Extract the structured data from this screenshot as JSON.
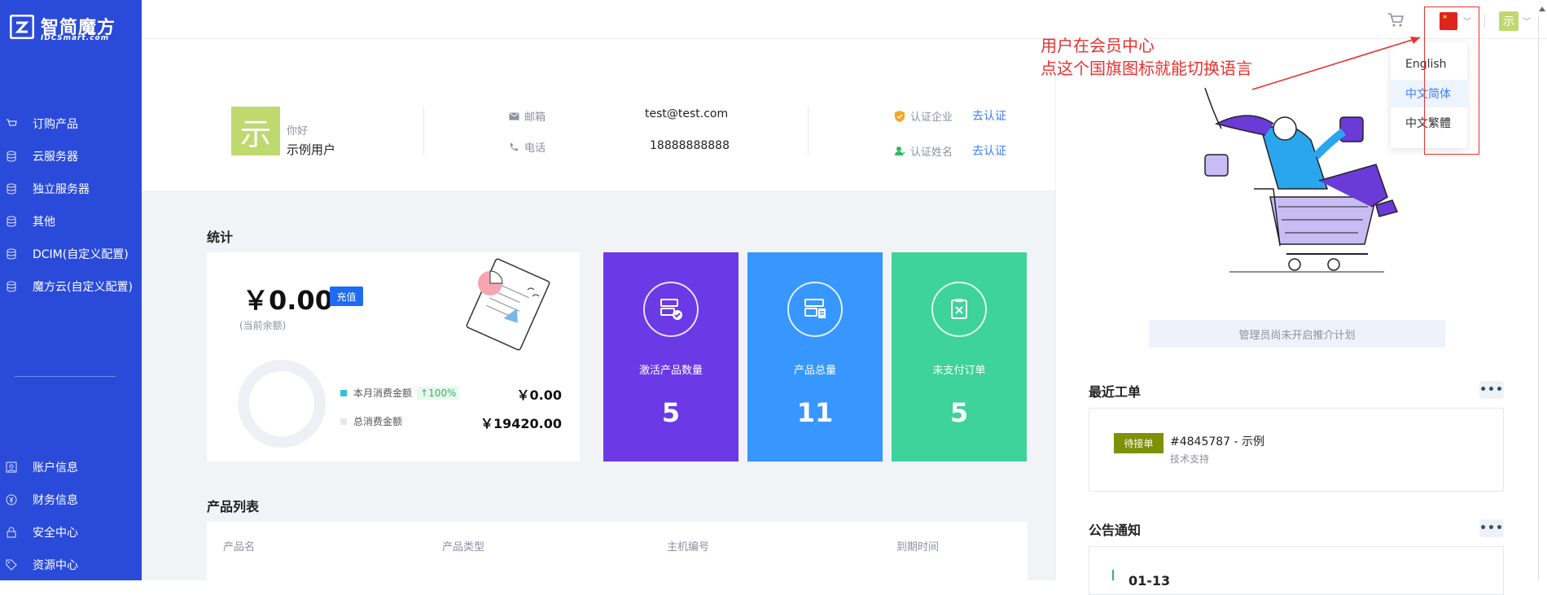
{
  "brand": {
    "name": "智简魔方",
    "sub": "IDCSmart.com"
  },
  "sidebar": {
    "items": [
      {
        "label": "订购产品",
        "icon": "cart-icon"
      },
      {
        "label": "云服务器",
        "icon": "database-icon"
      },
      {
        "label": "独立服务器",
        "icon": "database-icon"
      },
      {
        "label": "其他",
        "icon": "database-icon"
      },
      {
        "label": "DCIM(自定义配置)",
        "icon": "database-icon"
      },
      {
        "label": "魔方云(自定义配置)",
        "icon": "database-icon"
      }
    ],
    "bottom_items": [
      {
        "label": "账户信息",
        "icon": "user-card-icon"
      },
      {
        "label": "财务信息",
        "icon": "yen-icon"
      },
      {
        "label": "安全中心",
        "icon": "lock-icon"
      },
      {
        "label": "资源中心",
        "icon": "tag-icon"
      }
    ]
  },
  "user": {
    "avatar_char": "示",
    "greeting": "你好",
    "name": "示例用户",
    "email_label": "邮箱",
    "email": "test@test.com",
    "phone_label": "电话",
    "phone": "18888888888",
    "company_label": "认证企业",
    "company_action": "去认证",
    "realname_label": "认证姓名",
    "realname_action": "去认证"
  },
  "stats": {
    "title": "统计",
    "balance": "￥0.00",
    "recharge_label": "充值",
    "balance_sub": "(当前余额)",
    "month_label": "本月消费金额",
    "month_pct": "↑100%",
    "month_amount": "￥0.00",
    "total_label": "总消费金额",
    "total_amount": "￥19420.00",
    "cards": [
      {
        "label": "激活产品数量",
        "value": "5",
        "color": "#6b39e6",
        "icon": "server-check-icon"
      },
      {
        "label": "产品总量",
        "value": "11",
        "color": "#3797ff",
        "icon": "server-list-icon"
      },
      {
        "label": "未支付订单",
        "value": "5",
        "color": "#3ed39b",
        "icon": "clipboard-x-icon"
      }
    ]
  },
  "products": {
    "title": "产品列表",
    "columns": [
      "产品名",
      "产品类型",
      "主机编号",
      "到期时间"
    ]
  },
  "right": {
    "promo_text": "管理员尚未开启推介计划",
    "tickets_title": "最近工单",
    "more": "•••",
    "ticket": {
      "badge": "待接单",
      "title": "#4845787 - 示例",
      "sub": "技术支持"
    },
    "notices_title": "公告通知",
    "notice_date": "01-13"
  },
  "topbar": {
    "avatar_char": "示"
  },
  "language_menu": {
    "items": [
      "English",
      "中文简体",
      "中文繁體"
    ],
    "active_index": 1
  },
  "annotation": {
    "line1": "用户在会员中心",
    "line2": "点这个国旗图标就能切换语言"
  }
}
